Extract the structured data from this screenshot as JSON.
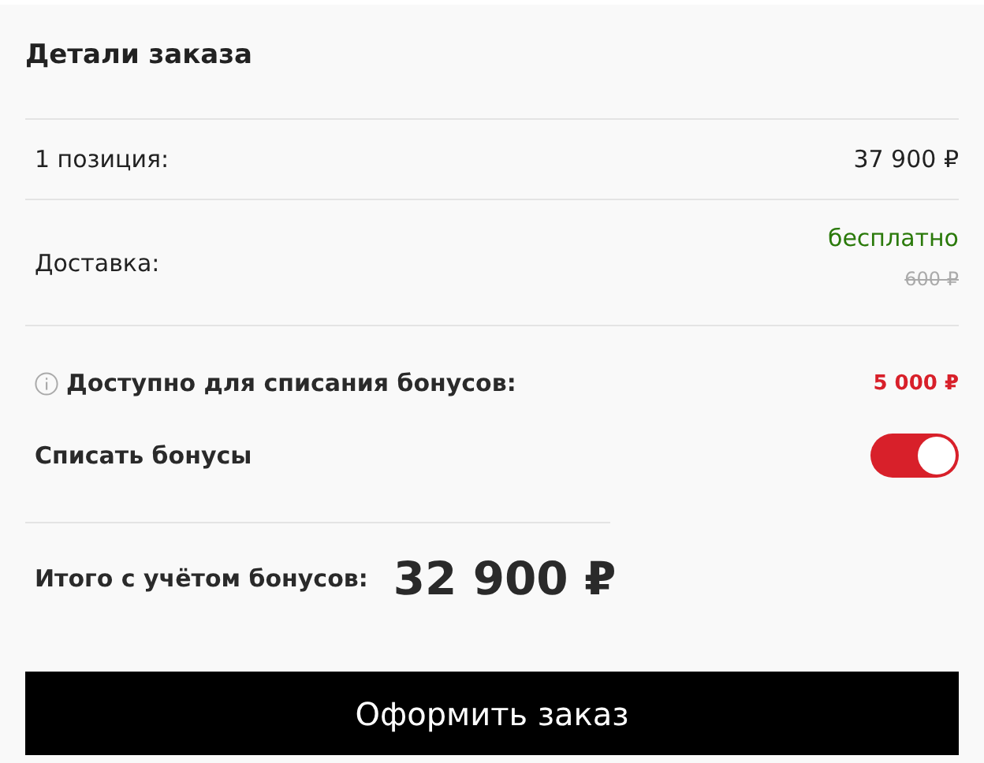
{
  "title": "Детали заказа",
  "items_row": {
    "label": "1 позиция:",
    "value": "37 900 ₽"
  },
  "delivery_row": {
    "label": "Доставка:",
    "value": "бесплатно",
    "old_value": "600 ₽"
  },
  "bonus_available": {
    "label": "Доступно для списания бонусов:",
    "value": "5 000 ₽"
  },
  "bonus_toggle": {
    "label": "Списать бонусы",
    "on": true
  },
  "total": {
    "label": "Итого с учётом бонусов:",
    "value": "32 900 ₽"
  },
  "checkout_button": "Оформить заказ"
}
